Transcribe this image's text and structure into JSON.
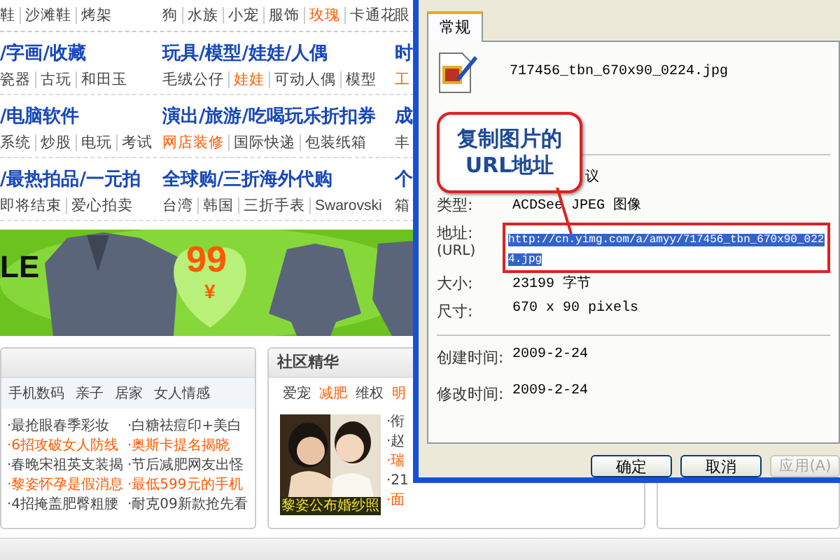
{
  "top_bar": [
    {
      "links": [
        {
          "text": "鞋",
          "hot": false
        },
        {
          "text": "沙滩鞋",
          "hot": false
        },
        {
          "text": "烤架",
          "hot": false
        }
      ]
    },
    {
      "links": [
        {
          "text": "狗",
          "hot": false
        },
        {
          "text": "水族",
          "hot": false
        },
        {
          "text": "小宠",
          "hot": false
        },
        {
          "text": "服饰",
          "hot": false
        },
        {
          "text": "玫瑰",
          "hot": true
        },
        {
          "text": "卡通花",
          "hot": false
        }
      ]
    },
    {
      "links": [
        {
          "text": "眼",
          "hot": false
        }
      ]
    }
  ],
  "categories": [
    {
      "cells": [
        {
          "title": "/字画/收藏",
          "links": [
            {
              "text": "瓷器",
              "hot": false
            },
            {
              "text": "古玩",
              "hot": false
            },
            {
              "text": "和田玉",
              "hot": false
            }
          ]
        },
        {
          "title": "玩具/模型/娃娃/人偶",
          "links": [
            {
              "text": "毛绒公仔",
              "hot": false
            },
            {
              "text": "娃娃",
              "hot": true
            },
            {
              "text": "可动人偶",
              "hot": false
            },
            {
              "text": "模型",
              "hot": false
            }
          ]
        },
        {
          "title": "时",
          "links": [
            {
              "text": "工",
              "hot": true
            }
          ]
        }
      ]
    },
    {
      "cells": [
        {
          "title": "/电脑软件",
          "links": [
            {
              "text": "系统",
              "hot": false
            },
            {
              "text": "炒股",
              "hot": false
            },
            {
              "text": "电玩",
              "hot": false
            },
            {
              "text": "考试",
              "hot": false
            }
          ]
        },
        {
          "title": "演出/旅游/吃喝玩乐折扣券",
          "links": [
            {
              "text": "网店装修",
              "hot": true
            },
            {
              "text": "国际快递",
              "hot": false
            },
            {
              "text": "包装纸箱",
              "hot": false
            }
          ]
        },
        {
          "title": "成",
          "links": [
            {
              "text": "丰",
              "hot": false
            }
          ]
        }
      ]
    },
    {
      "cells": [
        {
          "title": "/最热拍品/一元拍",
          "links": [
            {
              "text": "即将结束",
              "hot": false
            },
            {
              "text": "爱心拍卖",
              "hot": false
            }
          ]
        },
        {
          "title": "全球购/三折海外代购",
          "links": [
            {
              "text": "台湾",
              "hot": false
            },
            {
              "text": "韩国",
              "hot": false
            },
            {
              "text": "三折手表",
              "hot": false
            },
            {
              "text": "Swarovski",
              "hot": false
            }
          ]
        },
        {
          "title": "个",
          "links": [
            {
              "text": "箱",
              "hot": false
            }
          ]
        }
      ]
    }
  ],
  "banner": {
    "kind": "picture",
    "brand_fragment": "LE",
    "price": "99",
    "currency": "¥"
  },
  "news_panel": {
    "tabs": [
      "手机数码",
      "亲子",
      "居家",
      "女人情感"
    ],
    "items": [
      {
        "text": "·最抢眼春季彩妆",
        "hot": false
      },
      {
        "text": "·白糖祛痘印+美白",
        "hot": false
      },
      {
        "text": "·6招攻破女人防线",
        "hot": true
      },
      {
        "text": "·奥斯卡提名揭晓",
        "hot": true
      },
      {
        "text": "·春晚宋祖英支装揭",
        "hot": false
      },
      {
        "text": "·节后减肥网友出怪",
        "hot": false
      },
      {
        "text": "·黎姿怀孕是假消息",
        "hot": true
      },
      {
        "text": "·最低599元的手机",
        "hot": true
      },
      {
        "text": "·4招掩盖肥臀粗腰",
        "hot": false
      },
      {
        "text": "·耐克09新款抢先看",
        "hot": false
      }
    ]
  },
  "community_panel": {
    "title": "社区精华",
    "tabs": [
      {
        "text": "爱宠",
        "hot": false
      },
      {
        "text": "减肥",
        "hot": true
      },
      {
        "text": "维权",
        "hot": false
      },
      {
        "text": "明",
        "hot": true
      }
    ],
    "photo": {
      "kind": "picture",
      "caption": "黎姿公布婚纱照"
    },
    "items": [
      {
        "text": "·衔",
        "hot": false
      },
      {
        "text": "·赵",
        "hot": false
      },
      {
        "text": "·瑞",
        "hot": true
      },
      {
        "text": "·21",
        "hot": false
      },
      {
        "text": "·面",
        "hot": true
      }
    ]
  },
  "dialog": {
    "tabs": [
      {
        "label": "常规",
        "selected": true
      }
    ],
    "file_name": "717456_tbn_670x90_0224.jpg",
    "rows": [
      {
        "kind": "plain",
        "value": "议"
      },
      {
        "kind": "plain",
        "label": "类型:",
        "value": "ACDSee JPEG 图像"
      },
      {
        "kind": "url",
        "label": "地址:",
        "sublabel": "(URL)",
        "value": "http://cn.yimg.com/a/amyy/717456_tbn_670x90_0224.jpg"
      },
      {
        "kind": "plain",
        "label": "大小:",
        "value": "23199 字节"
      },
      {
        "kind": "plain",
        "label": "尺寸:",
        "value": "670  x  90  pixels"
      }
    ],
    "dates": [
      {
        "label": "创建时间:",
        "value": "2009-2-24"
      },
      {
        "label": "修改时间:",
        "value": "2009-2-24"
      }
    ],
    "buttons": [
      {
        "label": "确定",
        "disabled": false
      },
      {
        "label": "取消",
        "disabled": false
      },
      {
        "label": "应用(A)",
        "disabled": true
      }
    ]
  },
  "callout": {
    "lines": [
      "复制图片的",
      "URL地址"
    ]
  }
}
